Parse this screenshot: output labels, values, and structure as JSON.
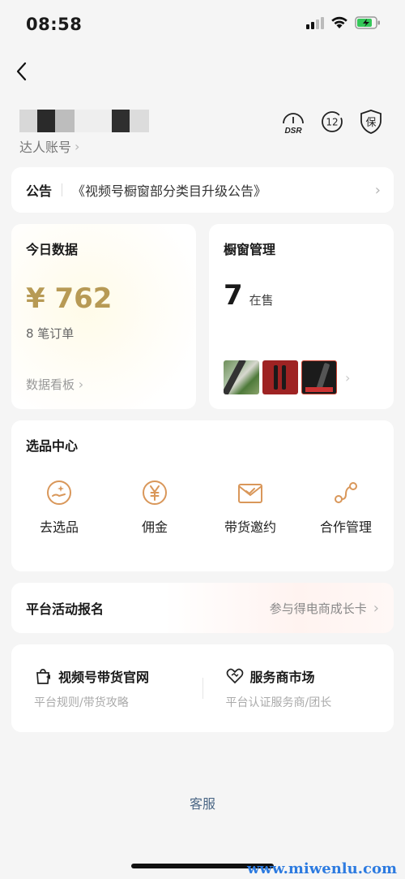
{
  "status_bar": {
    "time": "08:58"
  },
  "account": {
    "label": "达人账号",
    "badges": [
      "DSR",
      "12",
      "保"
    ]
  },
  "notice": {
    "label": "公告",
    "text": "《视频号橱窗部分类目升级公告》"
  },
  "today_data": {
    "title": "今日数据",
    "revenue": "¥ 762",
    "orders": "8 笔订单",
    "dashboard_link": "数据看板"
  },
  "window_manage": {
    "title": "橱窗管理",
    "count": "7",
    "count_label": "在售"
  },
  "select_center": {
    "title": "选品中心",
    "items": [
      {
        "label": "去选品",
        "icon": "select-product-icon"
      },
      {
        "label": "佣金",
        "icon": "commission-yen-icon"
      },
      {
        "label": "带货邀约",
        "icon": "invitation-mail-icon"
      },
      {
        "label": "合作管理",
        "icon": "cooperation-icon"
      }
    ]
  },
  "activity": {
    "title": "平台活动报名",
    "link": "参与得电商成长卡"
  },
  "links": [
    {
      "title": "视频号带货官网",
      "subtitle": "平台规则/带货攻略"
    },
    {
      "title": "服务商市场",
      "subtitle": "平台认证服务商/团长"
    }
  ],
  "footer": {
    "service": "客服",
    "watermark": "www.miwenlu.com"
  },
  "colors": {
    "gold": "#b79a55",
    "accent_orange": "#d9975a",
    "link_blue": "#4a6685"
  }
}
